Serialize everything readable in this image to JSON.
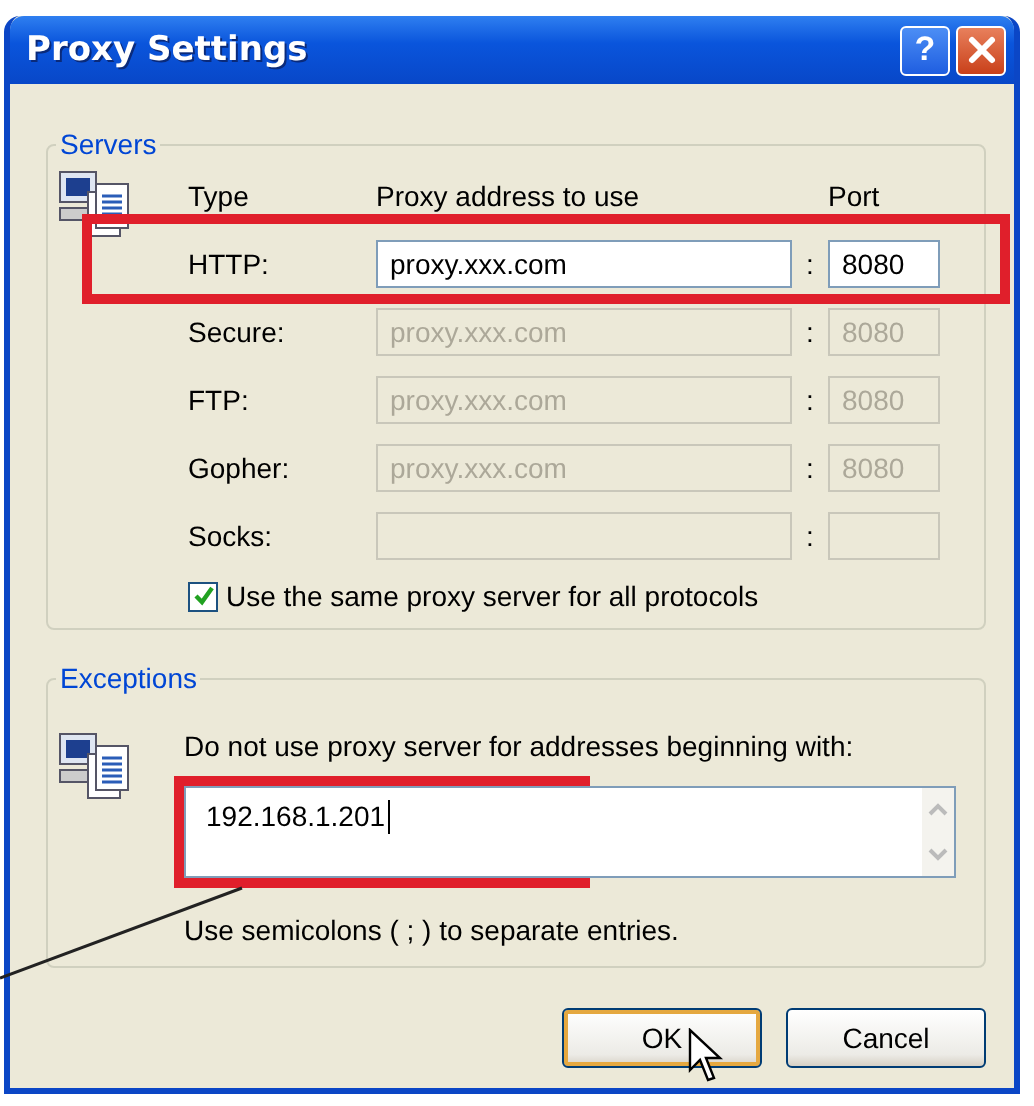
{
  "window": {
    "title": "Proxy Settings",
    "help_button": "?"
  },
  "servers": {
    "label": "Servers",
    "columns": [
      "Type",
      "Proxy address to use",
      "Port"
    ],
    "rows": [
      {
        "type": "HTTP:",
        "address": "proxy.xxx.com",
        "separator": ":",
        "port": "8080",
        "disabled": false
      },
      {
        "type": "Secure:",
        "address": "proxy.xxx.com",
        "separator": ":",
        "port": "8080",
        "disabled": true
      },
      {
        "type": "FTP:",
        "address": "proxy.xxx.com",
        "separator": ":",
        "port": "8080",
        "disabled": true
      },
      {
        "type": "Gopher:",
        "address": "proxy.xxx.com",
        "separator": ":",
        "port": "8080",
        "disabled": true
      },
      {
        "type": "Socks:",
        "separator": ":",
        "disabled": true
      }
    ],
    "same_proxy": {
      "label": "Use the same proxy server for all protocols",
      "checked": true
    }
  },
  "exceptions": {
    "label": "Exceptions",
    "instruction": "Do not use proxy server for addresses beginning with:",
    "value": "192.168.1.201",
    "hint": "Use semicolons ( ; ) to separate entries."
  },
  "buttons": [
    {
      "label": "OK",
      "default": true
    },
    {
      "label": "Cancel",
      "default": false
    }
  ]
}
